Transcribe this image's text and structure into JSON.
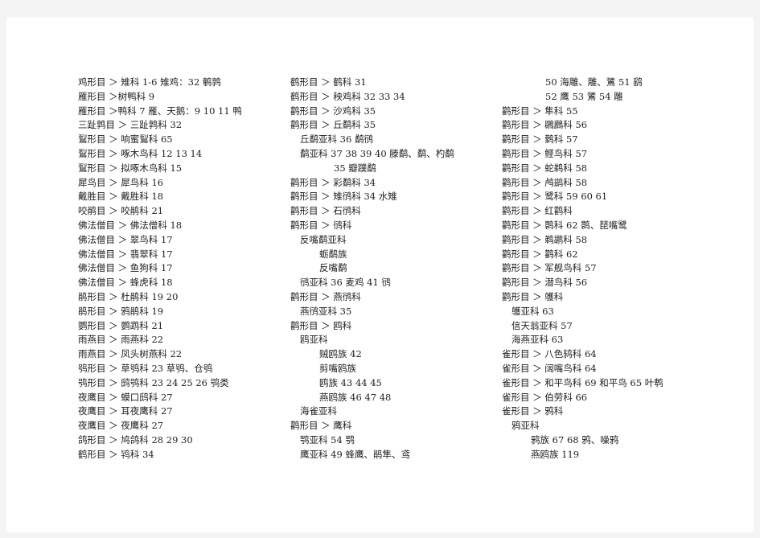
{
  "columns": [
    [
      {
        "text": "鸡形目 ＞ 雉科 1-6 雉鸡：32 鹌鹑",
        "level": 0
      },
      {
        "text": "雁形目 ＞树鸭科 9",
        "level": 0
      },
      {
        "text": "雁形目 ＞鸭科 7 雁、天鹅：9 10 11 鸭",
        "level": 0
      },
      {
        "text": "三趾鹑目 ＞ 三趾鹑科 32",
        "level": 0
      },
      {
        "text": "鴷形目 ＞ 响蜜鴷科 65",
        "level": 0
      },
      {
        "text": "鴷形目 ＞ 啄木鸟科 12 13 14",
        "level": 0
      },
      {
        "text": "鴷形目 ＞ 拟啄木鸟科 15",
        "level": 0
      },
      {
        "text": "犀鸟目 ＞ 犀鸟科 16",
        "level": 0
      },
      {
        "text": "戴胜目 ＞ 戴胜科 18",
        "level": 0
      },
      {
        "text": "咬鹃目 ＞ 咬鹃科 21",
        "level": 0
      },
      {
        "text": "佛法僧目 ＞ 佛法僧科 18",
        "level": 0
      },
      {
        "text": "佛法僧目 ＞ 翠鸟科 17",
        "level": 0
      },
      {
        "text": "佛法僧目 ＞ 翡翠科 17",
        "level": 0
      },
      {
        "text": "佛法僧目 ＞ 鱼狗科 17",
        "level": 0
      },
      {
        "text": "佛法僧目 ＞ 蜂虎科 18",
        "level": 0
      },
      {
        "text": "鹃形目 ＞ 杜鹃科 19 20",
        "level": 0
      },
      {
        "text": "鹃形目 ＞ 鸦鹃科 19",
        "level": 0
      },
      {
        "text": "鹦形目 ＞ 鹦鹉科 21",
        "level": 0
      },
      {
        "text": "雨燕目 ＞ 雨燕科 22",
        "level": 0
      },
      {
        "text": "雨燕目 ＞ 凤头树燕科 22",
        "level": 0
      },
      {
        "text": "鸮形目 ＞ 草鸮科 23 草鸮、仓鸮",
        "level": 0
      },
      {
        "text": "鸮形目 ＞ 鸱鸮科 23 24 25 26 鸮类",
        "level": 0
      },
      {
        "text": "夜鹰目 ＞ 蟆口鸱科 27",
        "level": 0
      },
      {
        "text": "夜鹰目 ＞ 耳夜鹰科 27",
        "level": 0
      },
      {
        "text": "夜鹰目 ＞ 夜鹰科 27",
        "level": 0
      },
      {
        "text": "鸽形目 ＞ 鸠鸽科 28 29 30",
        "level": 0
      },
      {
        "text": "鹤形目 ＞ 鸨科 34",
        "level": 0
      }
    ],
    [
      {
        "text": "鹤形目 ＞ 鹤科 31",
        "level": 0
      },
      {
        "text": "鹤形目 ＞ 秧鸡科 32 33 34",
        "level": 0
      },
      {
        "text": "鹳形目 ＞ 沙鸡科 35",
        "level": 0
      },
      {
        "text": "鹳形目 ＞ 丘鹬科 35",
        "level": 0
      },
      {
        "text": "丘鹬亚科 36 鹬鸻",
        "level": 1
      },
      {
        "text": "鹬亚科 37 38 39 40 滕鹬、鹬、杓鹬",
        "level": 1
      },
      {
        "text": "35 瓣蹼鹬",
        "level": 3
      },
      {
        "text": "鹳形目 ＞ 彩鹬科 34",
        "level": 0
      },
      {
        "text": "鹳形目 ＞ 雉鸻科 34 水雉",
        "level": 0
      },
      {
        "text": "鹳形目 ＞ 石鸻科",
        "level": 0
      },
      {
        "text": "鹳形目 ＞ 鸻科",
        "level": 0
      },
      {
        "text": "反嘴鹬亚科",
        "level": 1
      },
      {
        "text": "蛎鹬族",
        "level": 2
      },
      {
        "text": "反嘴鹬",
        "level": 2
      },
      {
        "text": "鸻亚科 36 麦鸡 41 鸻",
        "level": 1
      },
      {
        "text": "鹳形目 ＞ 燕鸻科",
        "level": 0
      },
      {
        "text": "燕鸻亚科 35",
        "level": 1
      },
      {
        "text": "鹳形目 ＞ 鸥科",
        "level": 0
      },
      {
        "text": "鸥亚科",
        "level": 1
      },
      {
        "text": "贼鸥族 42",
        "level": 2
      },
      {
        "text": "剪嘴鸥族",
        "level": 2
      },
      {
        "text": "鸥族 43 44 45",
        "level": 2
      },
      {
        "text": "燕鸥族 46 47 48",
        "level": 2
      },
      {
        "text": "海雀亚科",
        "level": 1
      },
      {
        "text": "鹳形目 ＞ 鹰科",
        "level": 0
      },
      {
        "text": "鹗亚科 54 鹗",
        "level": 1
      },
      {
        "text": "鹰亚科 49 蜂鹰、鹃隼、鸢",
        "level": 1
      }
    ],
    [
      {
        "text": "50 海雕、雕、鵟 51 鹞",
        "level": 3
      },
      {
        "text": "52 鹰 53 鵟 54 雕",
        "level": 3
      },
      {
        "text": "鹳形目 ＞ 隼科 55",
        "level": 0
      },
      {
        "text": "鹳形目 ＞ 鸊鷉科 56",
        "level": 0
      },
      {
        "text": "鹳形目 ＞ 鹲科 57",
        "level": 0
      },
      {
        "text": "鹳形目 ＞ 鲣鸟科 57",
        "level": 0
      },
      {
        "text": "鹳形目 ＞ 蛇鹈科 58",
        "level": 0
      },
      {
        "text": "鹳形目 ＞ 鸬鹚科 58",
        "level": 0
      },
      {
        "text": "鹳形目 ＞ 鹭科 59 60 61",
        "level": 0
      },
      {
        "text": "鹳形目 ＞ 红鹳科",
        "level": 0
      },
      {
        "text": "鹳形目 ＞ 鹮科 62 鹮、琵嘴鹭",
        "level": 0
      },
      {
        "text": "鹳形目 ＞ 鹈鹕科 58",
        "level": 0
      },
      {
        "text": "鹳形目 ＞ 鹳科 62",
        "level": 0
      },
      {
        "text": "鹳形目 ＞ 军舰鸟科 57",
        "level": 0
      },
      {
        "text": "鹳形目 ＞ 潜鸟科 56",
        "level": 0
      },
      {
        "text": "鹳形目 ＞ 鹱科",
        "level": 0
      },
      {
        "text": "鹱亚科 63",
        "level": 1
      },
      {
        "text": "信天翁亚科 57",
        "level": 1
      },
      {
        "text": "海燕亚科 63",
        "level": 1
      },
      {
        "text": "雀形目 ＞ 八色鸫科 64",
        "level": 0
      },
      {
        "text": "雀形目 ＞ 阔嘴鸟科 64",
        "level": 0
      },
      {
        "text": "雀形目 ＞ 和平鸟科 69 和平鸟 65 叶鹎",
        "level": 0
      },
      {
        "text": "雀形目 ＞ 伯劳科 66",
        "level": 0
      },
      {
        "text": "雀形目 ＞ 鸦科",
        "level": 0
      },
      {
        "text": "鸦亚科",
        "level": 1
      },
      {
        "text": "鸦族 67 68 鸦、噪鸦",
        "level": 2
      },
      {
        "text": "燕鸥族 119",
        "level": 2
      }
    ]
  ]
}
